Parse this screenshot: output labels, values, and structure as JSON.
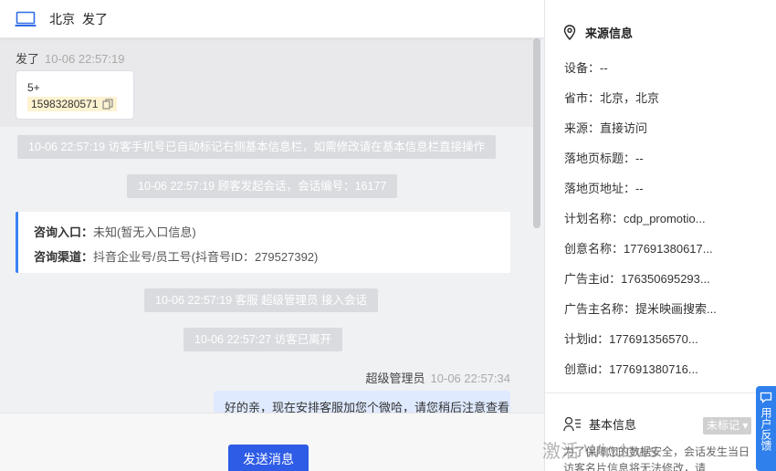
{
  "header": {
    "location": "北京",
    "visitor_name": "发了",
    "icon": "laptop-icon"
  },
  "visitor_message": {
    "sender": "发了",
    "time": "10-06 22:57:19",
    "line1": "5+",
    "phone": "15983280571"
  },
  "system_messages": [
    "10-06 22:57:19 访客手机号已自动标记右侧基本信息栏，如需修改请在基本信息栏直接操作",
    "10-06 22:57:19 顾客发起会话，会话编号：16177",
    "10-06 22:57:19 客服 超级管理员 接入会话",
    "10-06 22:57:27 访客已离开"
  ],
  "entry_card": {
    "entry_label": "咨询入口：",
    "entry_value": "未知(暂无入口信息)",
    "channel_label": "咨询渠道：",
    "channel_value": "抖音企业号/员工号(抖音号ID：279527392)"
  },
  "agent_message": {
    "sender": "超级管理员",
    "time": "10-06 22:57:34",
    "text": "好的亲，现在安排客服加您个微哈，请您稍后注意查看"
  },
  "footer": {
    "send_label": "发送消息"
  },
  "source_panel": {
    "title": "来源信息",
    "rows": [
      "设备：--",
      "省市：北京，北京",
      "来源：直接访问",
      "落地页标题：--",
      "落地页地址：--",
      "计划名称：cdp_promotio...",
      "创意名称：177691380617...",
      "广告主id：176350695293...",
      "广告主名称：提米映画搜索...",
      "计划id：177691356570...",
      "创意id：177691380716..."
    ]
  },
  "basic_info": {
    "title": "基本信息",
    "badge": "未标记",
    "desc": "为了保障您的数据安全，会话发生当日访客名片信息将无法修改，请"
  },
  "feedback": {
    "label": "用户反馈"
  },
  "watermark": "激活 Windows",
  "colors": {
    "accent": "#2e5ce6",
    "entry_border": "#3b82f6",
    "agent_bubble": "#dfeaff",
    "system_bg": "#d9dbdf",
    "feedback_bg": "#2f80ed"
  }
}
